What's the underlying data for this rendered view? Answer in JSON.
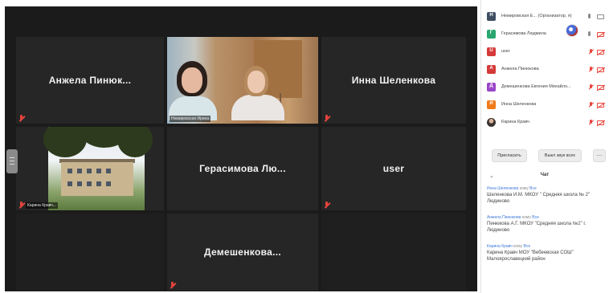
{
  "video_tiles": {
    "row1": [
      {
        "name": "Анжела Пинюк..."
      },
      {
        "caption": "Немировская Ирина"
      },
      {
        "name": "Инна Шеленкова"
      }
    ],
    "row2": [
      {
        "caption": "Карина Кравч..."
      },
      {
        "name": "Герасимова Лю..."
      },
      {
        "name": "user"
      }
    ],
    "row3": [
      {
        "name": "Демешенкова..."
      }
    ]
  },
  "participants": [
    {
      "letter": "Н",
      "color": "#3f4e63",
      "name": "Немировская Е... (Организатор, я)"
    },
    {
      "letter": "Г",
      "color": "#28a66d",
      "name": "Герасимова Людмила"
    },
    {
      "letter": "U",
      "color": "#d53a3a",
      "name": "user"
    },
    {
      "letter": "А",
      "color": "#d53a3a",
      "name": "Анжела Пинюкова"
    },
    {
      "letter": "Д",
      "color": "#9a45c8",
      "name": "Демешенкова Евгения Михайло..."
    },
    {
      "letter": "И",
      "color": "#f07a1a",
      "name": "Инна Шеленкова"
    },
    {
      "letter": "",
      "color": "#8a8a8a",
      "name": "Карина Кравч"
    }
  ],
  "buttons": {
    "invite": "Пригласить",
    "mute_all": "Выкл звук всех",
    "more": "..."
  },
  "chat": {
    "title": "Чат",
    "messages": [
      {
        "sender": "Инна Шеленкова",
        "to_prefix": "кому",
        "to": "Все",
        "text": "Шеленкова И.М. МКОУ \" Средняя школа № 2\" Людиново"
      },
      {
        "sender": "Анжела Пинюкова",
        "to_prefix": "кому",
        "to": "Все",
        "text": "Пинюкова А.Г. МКОУ \"Средняя школа №2\" г. Людиново"
      },
      {
        "sender": "Карина Кравч",
        "to_prefix": "кому",
        "to": "Все",
        "text": "Карина Кравч МОУ \"Вебеевская СОШ\" Малоярославецкий район"
      }
    ]
  }
}
